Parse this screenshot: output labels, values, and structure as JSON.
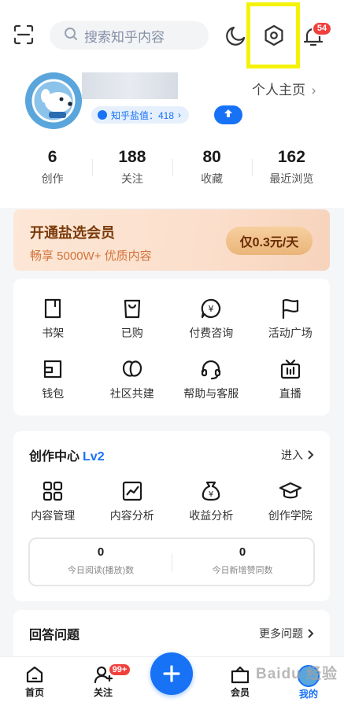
{
  "header": {
    "search_placeholder": "搜索知乎内容",
    "notification_count": "54"
  },
  "profile": {
    "homepage_label": "个人主页",
    "salt_value": "知乎盐值：418",
    "stats": [
      {
        "value": "6",
        "label": "创作"
      },
      {
        "value": "188",
        "label": "关注"
      },
      {
        "value": "80",
        "label": "收藏"
      },
      {
        "value": "162",
        "label": "最近浏览"
      }
    ]
  },
  "vip": {
    "title": "开通盐选会员",
    "subtitle": "畅享 5000W+ 优质内容",
    "button": "仅0.3元/天"
  },
  "services": {
    "row1": [
      {
        "label": "书架",
        "icon": "book-icon"
      },
      {
        "label": "已购",
        "icon": "shopping-bag-icon"
      },
      {
        "label": "付费咨询",
        "icon": "paid-consult-icon"
      },
      {
        "label": "活动广场",
        "icon": "flag-icon"
      }
    ],
    "row2": [
      {
        "label": "钱包",
        "icon": "wallet-icon"
      },
      {
        "label": "社区共建",
        "icon": "community-icon"
      },
      {
        "label": "帮助与客服",
        "icon": "headset-icon"
      },
      {
        "label": "直播",
        "icon": "live-tv-icon"
      }
    ]
  },
  "creator": {
    "title": "创作中心",
    "level": "Lv2",
    "enter_label": "进入",
    "tools": [
      {
        "label": "内容管理",
        "icon": "grid-icon"
      },
      {
        "label": "内容分析",
        "icon": "chart-icon"
      },
      {
        "label": "收益分析",
        "icon": "money-bag-icon"
      },
      {
        "label": "创作学院",
        "icon": "graduation-cap-icon"
      }
    ],
    "metrics": [
      {
        "value": "0",
        "label": "今日阅读(播放)数"
      },
      {
        "value": "0",
        "label": "今日新增赞同数"
      }
    ]
  },
  "answer": {
    "title": "回答问题",
    "more_label": "更多问题"
  },
  "tabbar": {
    "home": "首页",
    "follow": "关注",
    "follow_badge": "99+",
    "member": "会员",
    "me": "我的"
  },
  "watermark": "Baidu 经验",
  "colors": {
    "accent": "#1772f6",
    "badge": "#f1403c",
    "highlight": "#f5f20a"
  }
}
